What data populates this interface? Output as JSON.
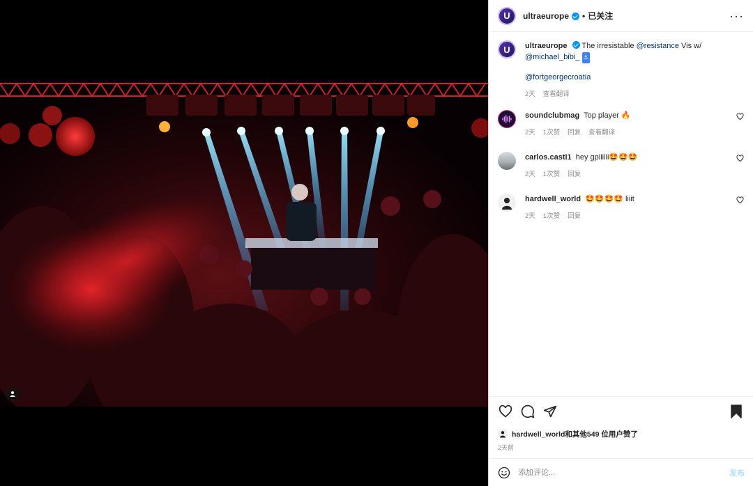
{
  "header": {
    "username": "ultraeurope",
    "separator": "•",
    "follow_status": "已关注",
    "avatar_letter": "U",
    "more_icon": "more-horizontal-icon"
  },
  "caption": {
    "username": "ultraeurope",
    "text_before": "The irresistable",
    "mention_1": "@resistance",
    "text_middle": "Vis w/",
    "mention_2": "@michael_bibi_",
    "badge": "⚓",
    "mention_3": "@fortgeorgecroatia",
    "time": "2天",
    "translate": "查看翻译"
  },
  "comments": [
    {
      "username": "soundclubmag",
      "text": "Top player 🔥",
      "time": "2天",
      "likes": "1次赞",
      "reply": "回复",
      "translate": "查看翻译"
    },
    {
      "username": "carlos.casti1",
      "text": "hey gpiiiiii🤩🤩🤩",
      "time": "2天",
      "likes": "1次赞",
      "reply": "回复"
    },
    {
      "username": "hardwell_world",
      "text": "🤩🤩🤩🤩 liiit",
      "time": "2天",
      "likes": "1次赞",
      "reply": "回复"
    }
  ],
  "actions": {
    "like_icon": "heart-icon",
    "comment_icon": "comment-icon",
    "share_icon": "share-icon",
    "save_icon": "bookmark-icon"
  },
  "likes_line": "hardwell_world和其他549 位用户赞了",
  "posted_ago": "2天前",
  "composer": {
    "placeholder": "添加评论...",
    "post_label": "发布",
    "emoji_icon": "emoji-icon"
  },
  "colors": {
    "link": "#00376b",
    "verified": "#0095f6",
    "muted": "#8e8e8e",
    "post_disabled": "#b2dffc"
  }
}
